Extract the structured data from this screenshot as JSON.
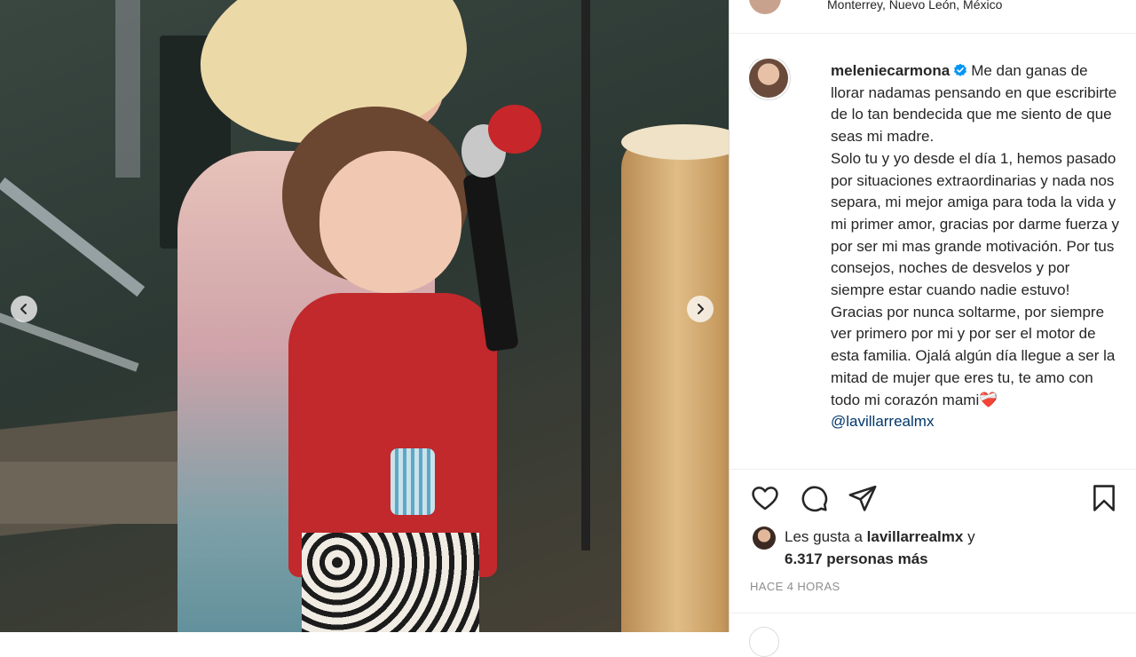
{
  "post": {
    "location": "Monterrey, Nuevo León, México",
    "username": "meleniecarmona",
    "caption": "Me dan ganas de llorar nadamas pensando en que escribirte de lo tan bendecida que me siento de que seas mi madre.\nSolo tu y yo desde el día 1, hemos pasado por situaciones extraordinarias y nada nos separa, mi mejor amiga para toda la vida y mi primer amor, gracias por darme fuerza y por ser mi mas grande motivación. Por tus consejos, noches de desvelos y por siempre estar cuando nadie estuvo! Gracias por nunca soltarme, por siempre ver primero por mi y por ser el motor de esta familia. Ojalá algún día llegue a ser la mitad de mujer que eres tu, te amo con todo mi corazón mami",
    "caption_emoji": "❤️‍🩹",
    "mention": "@lavillarrealmx",
    "likes_prefix": "Les gusta a",
    "likes_user": "lavillarrealmx",
    "likes_conj": "y",
    "likes_count": "6.317 personas más",
    "timestamp": "HACE 4 HORAS"
  },
  "icons": {
    "verified": "verified-badge-icon",
    "like": "heart-outline-icon",
    "comment": "comment-bubble-icon",
    "share": "paper-plane-icon",
    "save": "bookmark-icon",
    "prev": "chevron-left-icon",
    "next": "chevron-right-icon"
  },
  "colors": {
    "verified": "#0095f6",
    "text": "#262626",
    "muted": "#8e8e8e",
    "mention": "#00376b"
  }
}
